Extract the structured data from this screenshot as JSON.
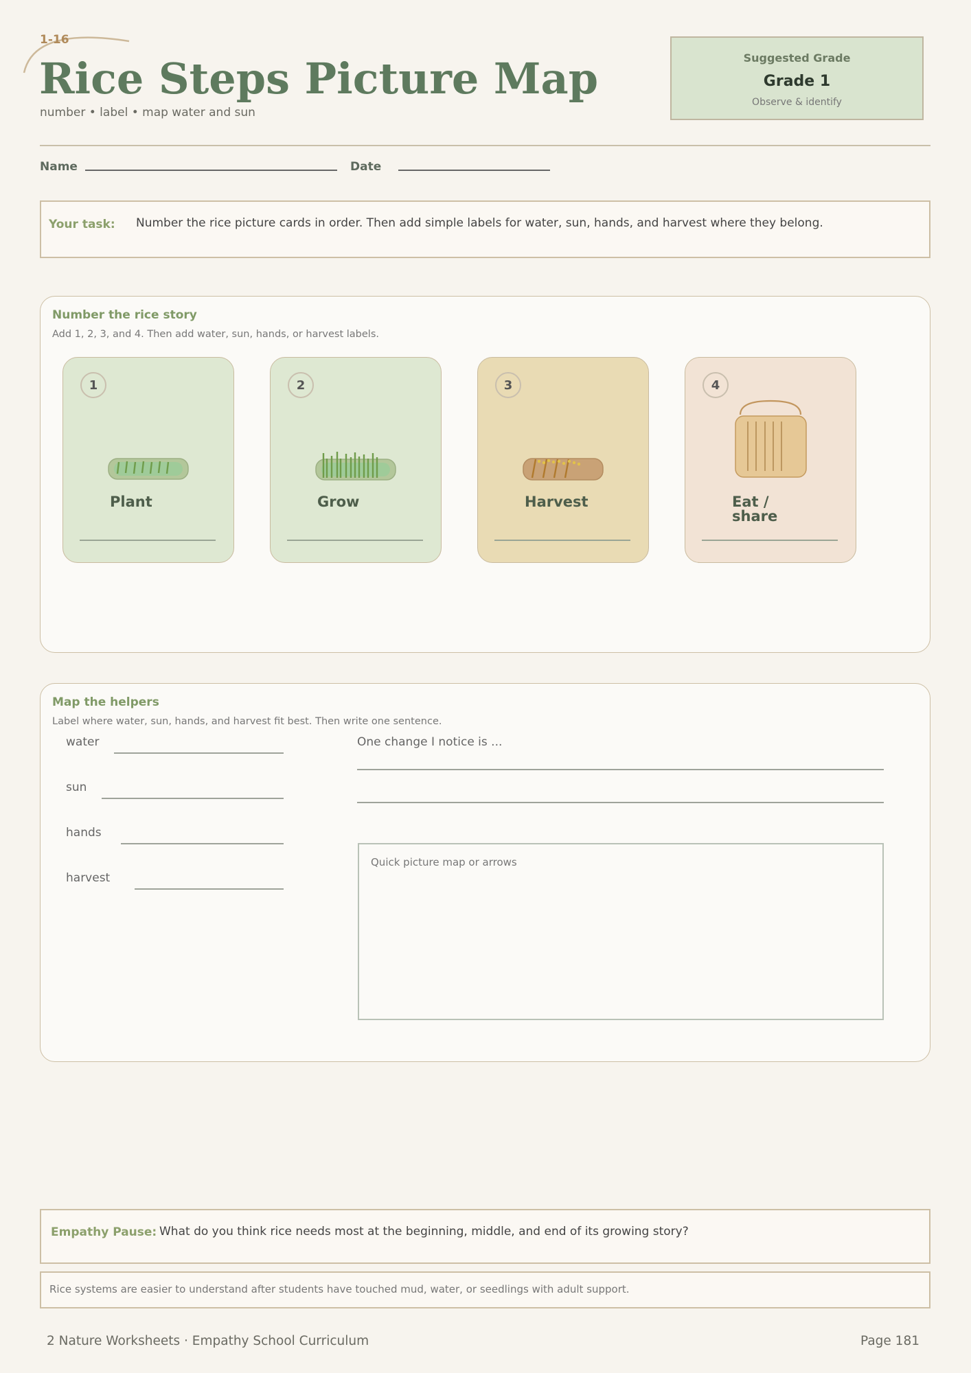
{
  "header": {
    "code": "1-16",
    "title": "Rice Steps Picture Map",
    "subtitle": "number • label • map water and sun",
    "grade_heading": "Suggested Grade",
    "grade": "Grade 1",
    "grade_note": "Observe & identify"
  },
  "fields": {
    "name_label": "Name",
    "date_label": "Date"
  },
  "task": {
    "label": "Your task:",
    "text": "Number the rice picture cards in order. Then add simple labels for water, sun, hands, and harvest where they belong."
  },
  "story": {
    "heading": "Number the rice story",
    "instructions": "Add 1, 2, 3, and 4. Then add water, sun, hands, or harvest labels.",
    "cards": [
      {
        "number": "1",
        "label": "Plant",
        "bg": "#dee8d2",
        "icon": "seedling-tray-icon"
      },
      {
        "number": "2",
        "label": "Grow",
        "bg": "#dee8d2",
        "icon": "growing-rice-icon"
      },
      {
        "number": "3",
        "label": "Harvest",
        "bg": "#e9dbb4",
        "icon": "harvest-bundle-icon"
      },
      {
        "number": "4",
        "label": "Eat /\nshare",
        "bg": "#f2e3d5",
        "icon": "rice-basket-icon"
      }
    ]
  },
  "helpers": {
    "heading": "Map the helpers",
    "instructions": "Label where water, sun, hands, and harvest fit best. Then write one sentence.",
    "labels": [
      "water",
      "sun",
      "hands",
      "harvest"
    ],
    "sentence_prompt": "One change I notice is ...",
    "sketch_label": "Quick picture map or arrows"
  },
  "empathy": {
    "label": "Empathy Pause:",
    "text": "What do you think rice needs most at the beginning, middle, and end of its growing story?"
  },
  "note": "Rice systems are easier to understand after students have touched mud, water, or seedlings with adult support.",
  "footer": {
    "left": "2 Nature Worksheets · Empathy School Curriculum",
    "right": "Page 181"
  }
}
